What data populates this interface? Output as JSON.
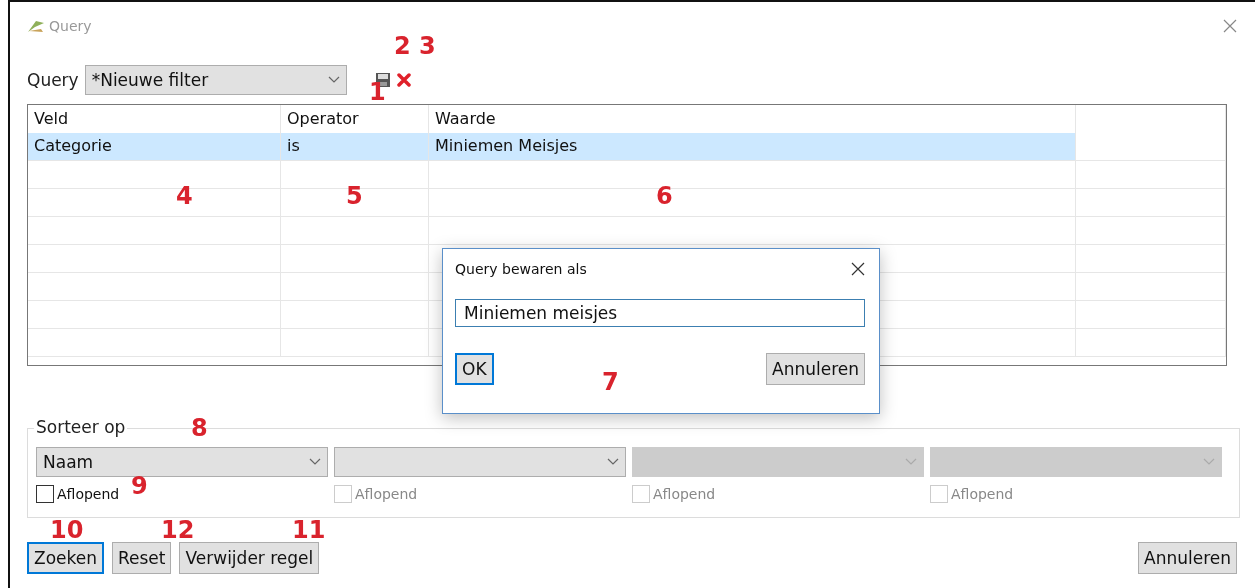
{
  "window": {
    "title": "Query"
  },
  "query": {
    "label": "Query",
    "value": "*Nieuwe filter"
  },
  "table": {
    "columns": [
      "Veld",
      "Operator",
      "Waarde"
    ],
    "rows": [
      {
        "cells": [
          "Categorie",
          "is",
          "Miniemen Meisjes"
        ],
        "selected": true
      }
    ]
  },
  "save_dialog": {
    "title": "Query bewaren als",
    "value": "Miniemen meisjes",
    "ok": "OK",
    "cancel": "Annuleren"
  },
  "sort": {
    "title": "Sorteer op",
    "fields": [
      {
        "value": "Naam",
        "disabled": false,
        "checkbox": {
          "label": "Aflopend",
          "checked": false,
          "disabled": false
        }
      },
      {
        "disabled": false,
        "checkbox": {
          "label": "Aflopend",
          "checked": false,
          "disabled": true
        }
      },
      {
        "disabled": true,
        "checkbox": {
          "label": "Aflopend",
          "checked": false,
          "disabled": true
        }
      },
      {
        "disabled": true,
        "checkbox": {
          "label": "Aflopend",
          "checked": false,
          "disabled": true
        }
      }
    ]
  },
  "buttons": [
    {
      "label": "Zoeken",
      "focused": true
    },
    {
      "label": "Reset",
      "focused": false
    },
    {
      "label": "Verwijder regel",
      "focused": false
    }
  ],
  "cancel": "Annuleren",
  "annotations": [
    {
      "label": "2"
    },
    {
      "label": "3"
    },
    {
      "label": "1"
    },
    {
      "label": "4"
    },
    {
      "label": "5"
    },
    {
      "label": "6"
    },
    {
      "label": "7"
    },
    {
      "label": "8"
    },
    {
      "label": "9"
    },
    {
      "label": "10"
    },
    {
      "label": "12"
    },
    {
      "label": "11"
    }
  ]
}
